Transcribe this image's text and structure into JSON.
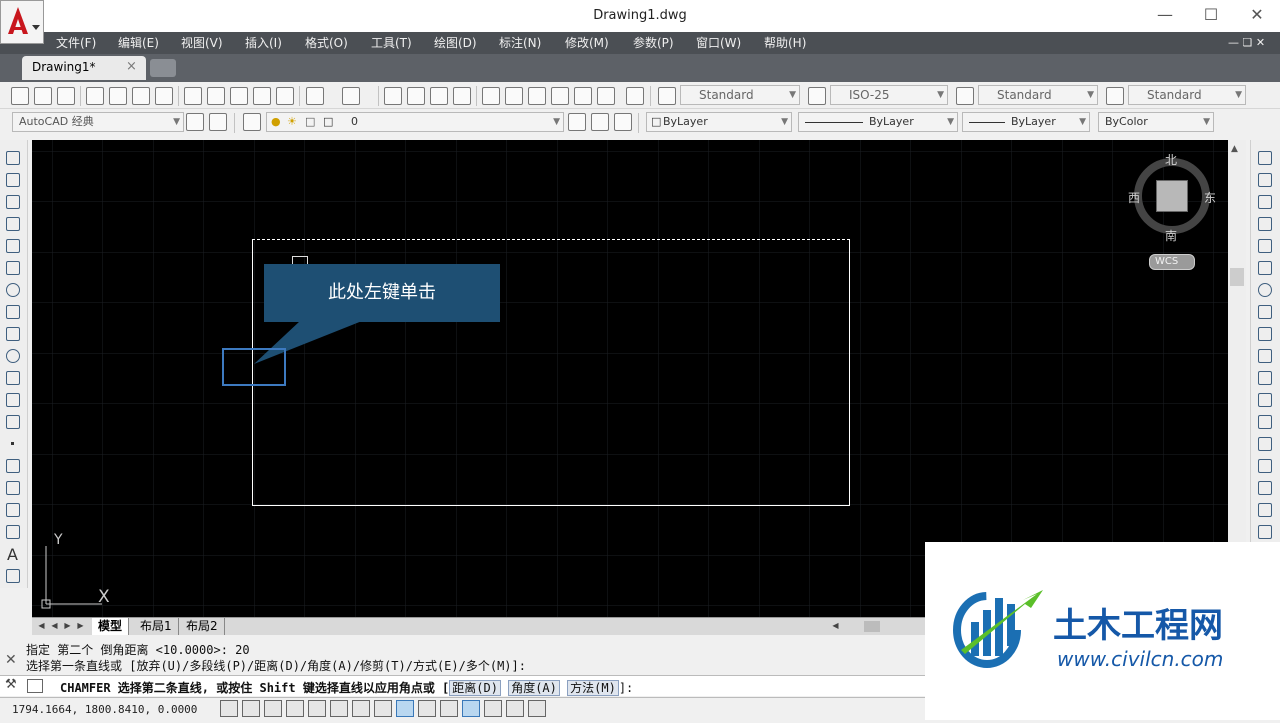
{
  "window": {
    "title": "Drawing1.dwg",
    "minimize_icon": "minimize-icon",
    "maximize_icon": "maximize-icon",
    "close_icon": "close-icon"
  },
  "menu": [
    "文件(F)",
    "编辑(E)",
    "视图(V)",
    "插入(I)",
    "格式(O)",
    "工具(T)",
    "绘图(D)",
    "标注(N)",
    "修改(M)",
    "参数(P)",
    "窗口(W)",
    "帮助(H)"
  ],
  "tabs": [
    {
      "label": "Drawing1*",
      "close": "×"
    }
  ],
  "toolbar": {
    "text_style": "Standard",
    "dim_style": "ISO-25",
    "table_style": "Standard",
    "multileader_style": "Standard",
    "workspace": "AutoCAD 经典",
    "layer": "0",
    "color": "ByLayer",
    "linetype": "ByLayer",
    "lineweight": "ByLayer",
    "plotstyle": "ByColor"
  },
  "viewcube": {
    "north": "北",
    "south": "南",
    "east": "东",
    "west": "西",
    "wcs": "WCS"
  },
  "callout": {
    "text": "此处左键单击"
  },
  "ucs": {
    "y": "Y",
    "x": "X"
  },
  "layout_tabs": [
    "模型",
    "布局1",
    "布局2"
  ],
  "command": {
    "line1": "指定 第二个 倒角距离 <10.0000>: 20",
    "line2": "选择第一条直线或 [放弃(U)/多段线(P)/距离(D)/角度(A)/修剪(T)/方式(E)/多个(M)]:",
    "prompt_prefix": "CHAMFER 选择第二条直线, 或按住 Shift 键选择直线以应用角点或 [",
    "options": [
      "距离(D)",
      "角度(A)",
      "方法(M)"
    ],
    "prompt_suffix": "]:"
  },
  "status": {
    "coords": "1794.1664, 1800.8410, 0.0000"
  },
  "watermark": {
    "brand": "土木工程网",
    "url": "www.civilcn.com"
  },
  "colors": {
    "menubar": "#4b4f54",
    "canvas": "#000000",
    "grid": "#1c1f24",
    "callout": "#1e4f73",
    "accent": "#3d7ac0"
  }
}
